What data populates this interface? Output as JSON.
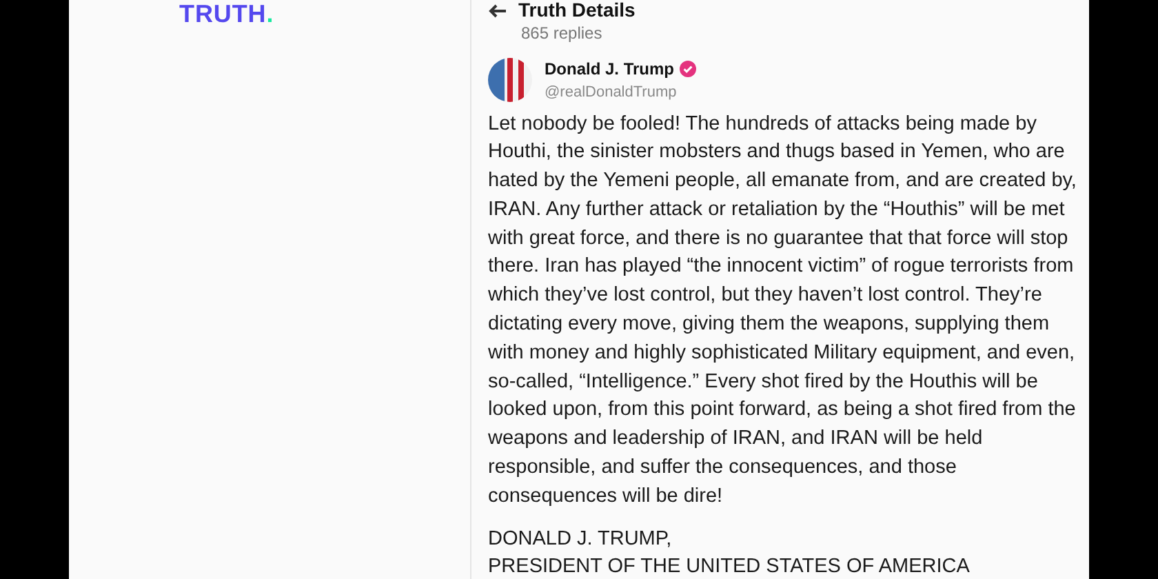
{
  "logo": {
    "text": "TRUTH",
    "dot": "."
  },
  "header": {
    "title": "Truth Details",
    "subtitle": "865 replies"
  },
  "post": {
    "author": {
      "name": "Donald J. Trump",
      "handle": "@realDonaldTrump",
      "verified": true
    },
    "body": "Let nobody be fooled! The hundreds of attacks being made by Houthi, the sinister mobsters and thugs based in Yemen, who are hated by the Yemeni people, all emanate from, and are created by, IRAN. Any further attack or retaliation by the “Houthis” will be met with great force, and there is no guarantee that that force will stop there. Iran has played “the innocent victim” of rogue terrorists from which they’ve lost control, but they haven’t lost control. They’re dictating every move, giving them the weapons, supplying them with money and highly sophisticated Military equipment, and even, so-called, “Intelligence.” Every shot fired by the Houthis will be looked upon, from this point forward, as being a shot fired from the weapons and leadership of IRAN, and IRAN will be held responsible, and suffer the consequences, and those consequences will be dire!",
    "signature": [
      "DONALD J. TRUMP,",
      "PRESIDENT OF THE UNITED STATES OF AMERICA"
    ]
  }
}
